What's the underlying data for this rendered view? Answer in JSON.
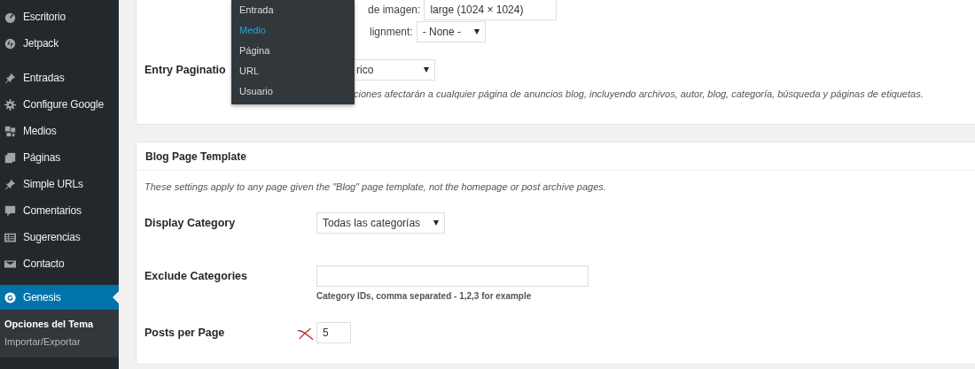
{
  "sidebar": {
    "items": [
      {
        "label": "Escritorio",
        "kind": "dashboard",
        "selected": false
      },
      {
        "label": "Jetpack",
        "kind": "jetpack",
        "selected": false
      },
      {
        "label": "Entradas",
        "kind": "pin",
        "selected": false
      },
      {
        "label": "Configure Google",
        "kind": "gear",
        "selected": false
      },
      {
        "label": "Medios",
        "kind": "media",
        "selected": false
      },
      {
        "label": "Páginas",
        "kind": "pages",
        "selected": false
      },
      {
        "label": "Simple URLs",
        "kind": "pin",
        "selected": false
      },
      {
        "label": "Comentarios",
        "kind": "comment",
        "selected": false
      },
      {
        "label": "Sugerencias",
        "kind": "list",
        "selected": false
      },
      {
        "label": "Contacto",
        "kind": "mail",
        "selected": false
      },
      {
        "label": "Genesis",
        "kind": "genesis",
        "selected": true,
        "children": [
          {
            "label": "Opciones del Tema",
            "selected": true
          },
          {
            "label": "Importar/Exportar",
            "selected": false
          }
        ]
      }
    ]
  },
  "top_panel": {
    "image_size_label": "de imagen:",
    "image_size_value": "large (1024 × 1024)",
    "alignment_label": "lignment:",
    "alignment_value": "- None -",
    "entry_pagination_label": "Entry Paginatio",
    "entry_pagination_value": "rico",
    "description": "ciones afectarán a cualquier página de anuncios blog, incluyendo archivos, autor, blog, categoría, búsqueda y páginas de etiquetas."
  },
  "dropdown_menu": {
    "items": [
      {
        "label": "Entrada",
        "selected": false
      },
      {
        "label": "Medio",
        "selected": true
      },
      {
        "label": "Página",
        "selected": false
      },
      {
        "label": "URL",
        "selected": false
      },
      {
        "label": "Usuario",
        "selected": false
      }
    ]
  },
  "blog_panel": {
    "title": "Blog Page Template",
    "description": "These settings apply to any page given the \"Blog\" page template, not the homepage or post archive pages.",
    "fields": [
      {
        "kind": "select",
        "label": "Display Category",
        "value": "Todas las categorías"
      },
      {
        "kind": "text",
        "label": "Exclude Categories",
        "hint": "Category IDs, comma separated - 1,2,3 for example"
      },
      {
        "kind": "number",
        "label": "Posts per Page",
        "value": "5",
        "marked": true
      }
    ]
  }
}
